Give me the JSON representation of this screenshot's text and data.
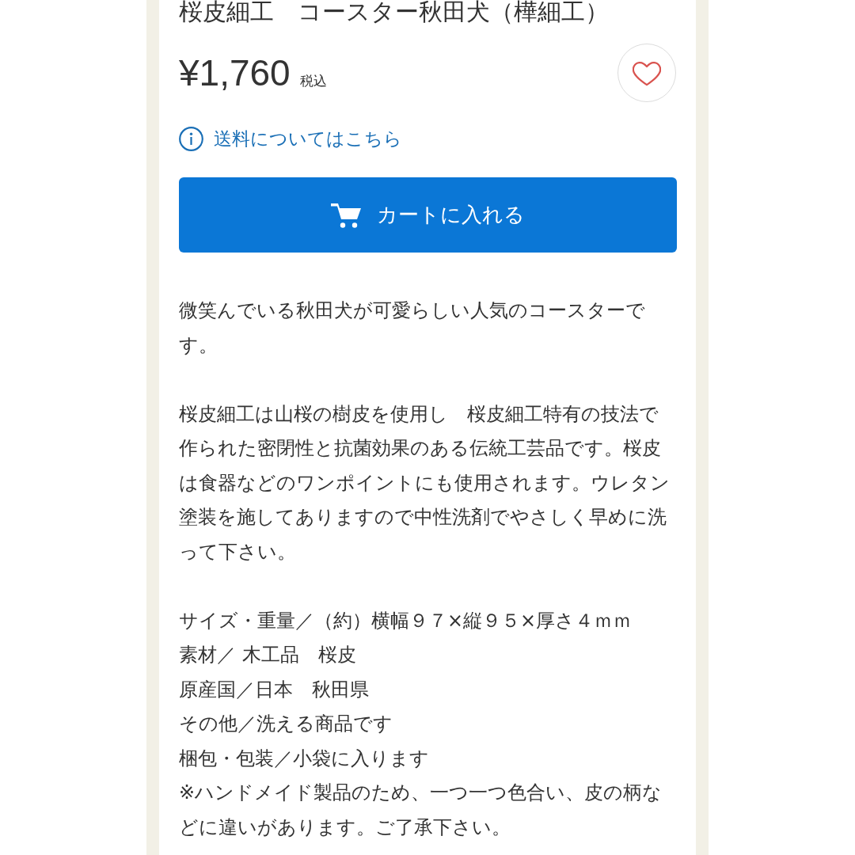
{
  "product": {
    "title": "桜皮細工　コースター秋田犬（樺細工）",
    "price": "¥1,760",
    "tax_note": "税込",
    "favorited": false
  },
  "shipping_link": "送料についてはこちら",
  "cart_button": "カートに入れる",
  "description": {
    "paragraphs": [
      "微笑んでいる秋田犬が可愛らしい人気のコースターです。",
      "桜皮細工は山桜の樹皮を使用し　桜皮細工特有の技法で作られた密閉性と抗菌効果のある伝統工芸品です。桜皮は食器などのワンポイントにも使用されます。ウレタン塗装を施してありますので中性洗剤でやさしく早めに洗って下さい。"
    ],
    "specs": [
      "サイズ・重量／（約）横幅９７×縦９５×厚さ４ｍｍ",
      "素材／ 木工品　桜皮",
      "原産国／日本　秋田県",
      "その他／洗える商品です",
      "梱包・包装／小袋に入ります",
      "※ハンドメイド製品のため、一つ一つ色合い、皮の柄などに違いがあります。ご了承下さい。"
    ]
  }
}
